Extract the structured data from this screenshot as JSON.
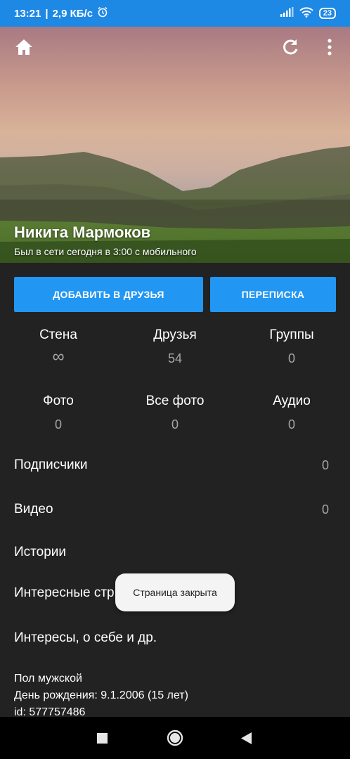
{
  "status_bar": {
    "time": "13:21",
    "speed": "2,9 КБ/с",
    "battery": "23",
    "icons": [
      "alarm-icon",
      "signal-icon",
      "wifi-icon",
      "battery-icon"
    ]
  },
  "header": {
    "icons": [
      "home-icon",
      "refresh-icon",
      "more-vert-icon"
    ],
    "name": "Никита Мармоков",
    "online_status": "Был в сети сегодня в 3:00 с мобильного"
  },
  "actions": {
    "add_friend": "ДОБАВИТЬ В ДРУЗЬЯ",
    "messages": "ПЕРЕПИСКА"
  },
  "counters": [
    {
      "label": "Стена",
      "value": "∞"
    },
    {
      "label": "Друзья",
      "value": "54"
    },
    {
      "label": "Группы",
      "value": "0"
    },
    {
      "label": "Фото",
      "value": "0"
    },
    {
      "label": "Все фото",
      "value": "0"
    },
    {
      "label": "Аудио",
      "value": "0"
    }
  ],
  "list": [
    {
      "label": "Подписчики",
      "value": "0"
    },
    {
      "label": "Видео",
      "value": "0"
    },
    {
      "label": "Истории",
      "value": ""
    },
    {
      "label": "Интересные стр",
      "value": ""
    },
    {
      "label": "Интересы, о себе и др.",
      "value": ""
    }
  ],
  "info": {
    "gender": "Пол мужской",
    "birthday": "День рождения: 9.1.2006 (15 лет)",
    "id": "id: 577757486"
  },
  "toast": "Страница закрыта",
  "colors": {
    "accent": "#2196f3",
    "status_bar": "#1e88e5",
    "background": "#222222"
  }
}
